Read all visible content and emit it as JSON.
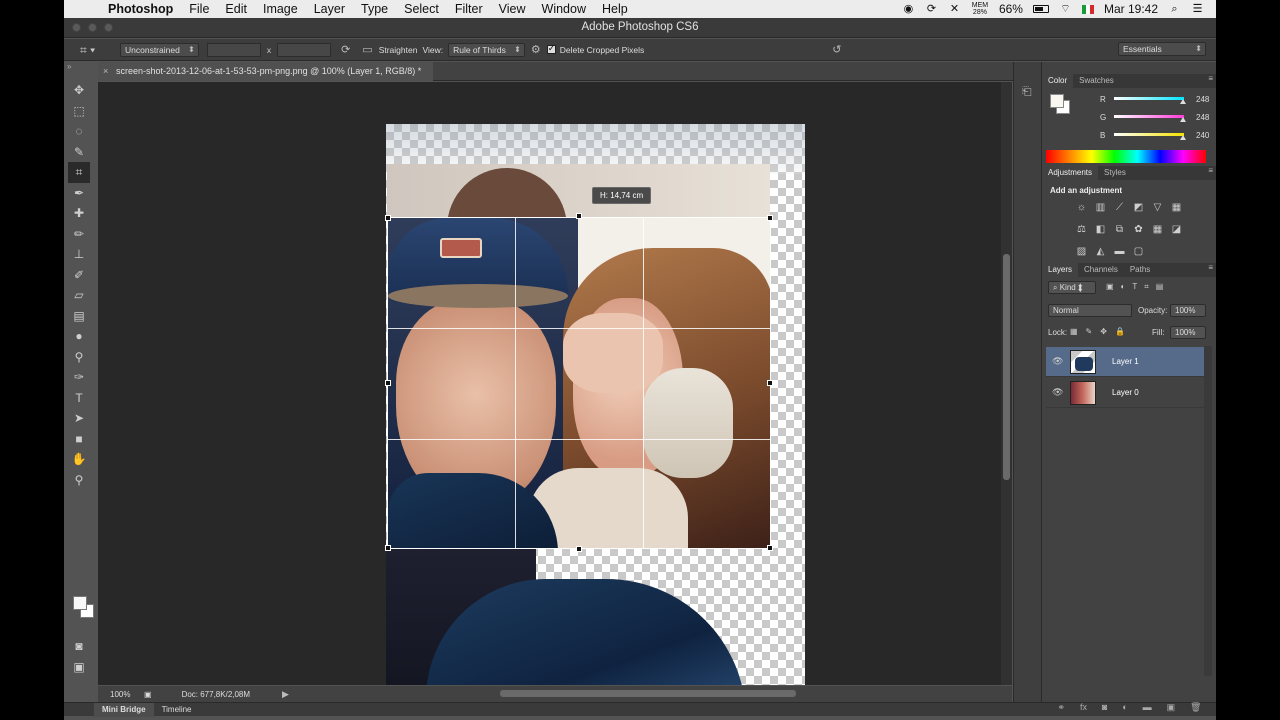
{
  "menubar": {
    "apple": "",
    "app_name": "Photoshop",
    "items": [
      "File",
      "Edit",
      "Image",
      "Layer",
      "Type",
      "Select",
      "Filter",
      "View",
      "Window",
      "Help"
    ],
    "mem_label": "MEM",
    "mem_value": "28%",
    "battery": "66%",
    "clock": "Mar 19:42",
    "icons": [
      "record-icon",
      "sync-icon",
      "tools-icon",
      "battery-icon",
      "wifi-icon",
      "flag-italy-icon",
      "search-icon",
      "list-icon"
    ]
  },
  "window": {
    "title": "Adobe Photoshop CS6"
  },
  "options": {
    "preset": "Unconstrained",
    "x_sep": "x",
    "straighten": "Straighten",
    "view_label": "View:",
    "view_value": "Rule of Thirds",
    "delete_cropped": "Delete Cropped Pixels",
    "delete_cropped_checked": true,
    "workspace": "Essentials"
  },
  "document": {
    "tab_title": "screen-shot-2013-12-06-at-1-53-53-pm-png.png @ 100% (Layer 1, RGB/8) *",
    "tab_close": "×",
    "crop_tooltip": "H: 14,74 cm"
  },
  "status": {
    "zoom": "100%",
    "doc_info": "Doc: 677,8K/2,08M"
  },
  "bottom_tabs": [
    "Mini Bridge",
    "Timeline"
  ],
  "color_panel": {
    "tabs": [
      "Color",
      "Swatches"
    ],
    "channels": [
      {
        "name": "R",
        "value": "248",
        "color": "#00e5ff"
      },
      {
        "name": "G",
        "value": "248",
        "color": "#ff3bd8"
      },
      {
        "name": "B",
        "value": "240",
        "color": "#f2e200"
      }
    ],
    "foreground": "#f8f8f0"
  },
  "adjustments_panel": {
    "tabs": [
      "Adjustments",
      "Styles"
    ],
    "title": "Add an adjustment",
    "icons": [
      "brightness-icon",
      "levels-icon",
      "curves-icon",
      "exposure-icon",
      "vibrance-icon",
      "hue-saturation-icon",
      "color-balance-icon",
      "black-white-icon",
      "photo-filter-icon",
      "channel-mixer-icon",
      "color-lookup-icon",
      "invert-icon",
      "posterize-icon",
      "threshold-icon",
      "gradient-map-icon",
      "selective-color-icon"
    ]
  },
  "layers_panel": {
    "tabs": [
      "Layers",
      "Channels",
      "Paths"
    ],
    "filter_kind": "Kind",
    "blend_mode": "Normal",
    "opacity_label": "Opacity:",
    "opacity_value": "100%",
    "lock_label": "Lock:",
    "fill_label": "Fill:",
    "fill_value": "100%",
    "layers": [
      {
        "name": "Layer 1",
        "selected": true,
        "visible": true
      },
      {
        "name": "Layer 0",
        "selected": false,
        "visible": true
      }
    ]
  },
  "colors": {
    "accent_selected": "#566a8a",
    "panel_bg": "#424242",
    "canvas_bg": "#282828"
  }
}
